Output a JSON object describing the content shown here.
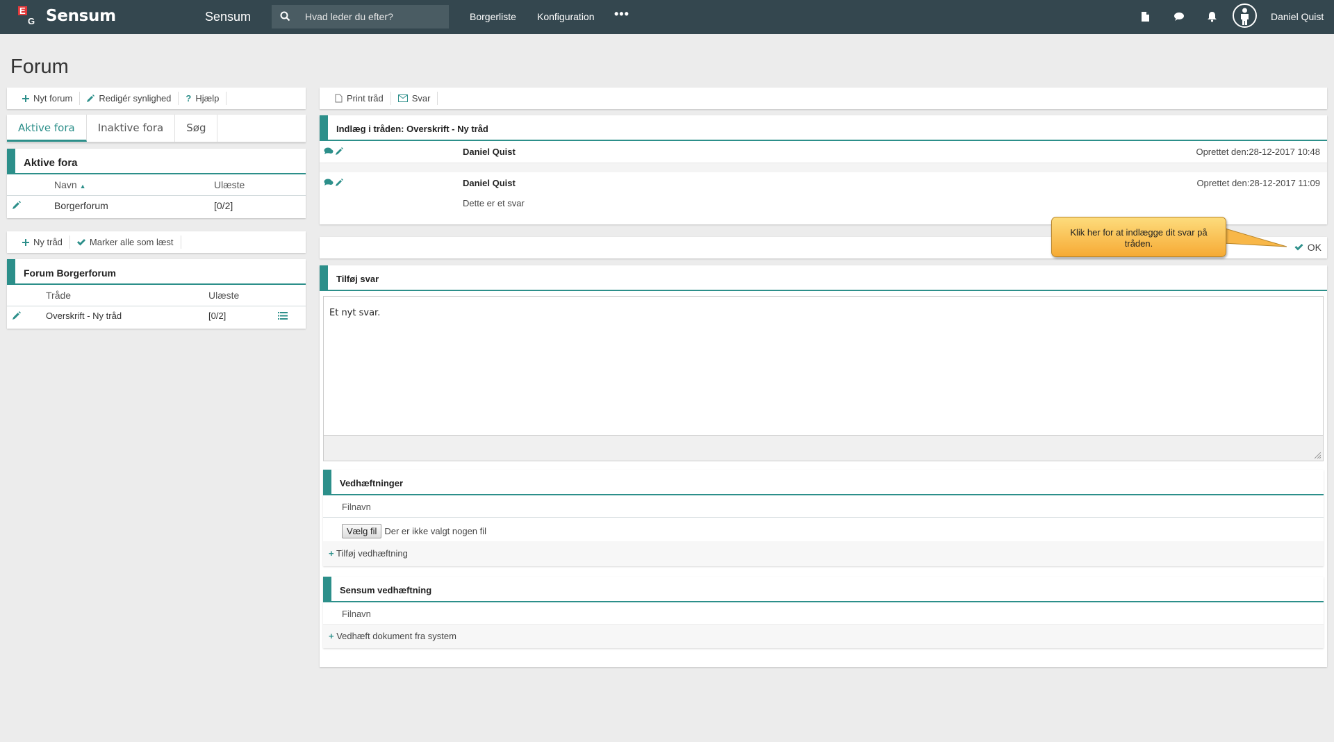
{
  "header": {
    "logo_letters": [
      "E",
      "G"
    ],
    "brand": "Sensum",
    "app_name": "Sensum",
    "search_placeholder": "Hvad leder du efter?",
    "nav": [
      "Borgerliste",
      "Konfiguration"
    ],
    "more": "•••",
    "user_name": "Daniel Quist"
  },
  "page": {
    "title": "Forum"
  },
  "left_toolbar": {
    "new_forum": "Nyt forum",
    "edit_visibility": "Redigér synlighed",
    "help": "Hjælp"
  },
  "forum_tabs": [
    "Aktive fora",
    "Inaktive fora",
    "Søg"
  ],
  "active_forums": {
    "title": "Aktive fora",
    "columns": {
      "name": "Navn",
      "unread": "Ulæste"
    },
    "rows": [
      {
        "name": "Borgerforum",
        "unread": "[0/2]"
      }
    ]
  },
  "thread_toolbar": {
    "new_thread": "Ny tråd",
    "mark_read": "Marker alle som læst"
  },
  "forum_threads": {
    "title": "Forum Borgerforum",
    "columns": {
      "thread": "Tråde",
      "unread": "Ulæste"
    },
    "rows": [
      {
        "thread": "Overskrift - Ny tråd",
        "unread": "[0/2]"
      }
    ]
  },
  "right_toolbar": {
    "print": "Print tråd",
    "reply": "Svar"
  },
  "thread_posts": {
    "title": "Indlæg i tråden: Overskrift - Ny tråd",
    "posts": [
      {
        "author": "Daniel Quist",
        "created": "Oprettet den:28-12-2017 10:48",
        "text": ""
      },
      {
        "author": "Daniel Quist",
        "created": "Oprettet den:28-12-2017 11:09",
        "text": "Dette er et svar"
      }
    ]
  },
  "ok_button": "OK",
  "tooltip": "Klik her for at indlægge dit svar på tråden.",
  "reply_form": {
    "title": "Tilføj svar",
    "text": "Et nyt svar."
  },
  "attachments": {
    "title": "Vedhæftninger",
    "column": "Filnavn",
    "choose_file": "Vælg fil",
    "no_file": "Der er ikke valgt nogen fil",
    "add": "Tilføj vedhæftning"
  },
  "sensum_attachment": {
    "title": "Sensum vedhæftning",
    "column": "Filnavn",
    "add": "Vedhæft dokument fra system"
  },
  "colors": {
    "topbar": "#34474f",
    "accent": "#2c8f8a",
    "tooltip": "#f6aa34"
  }
}
